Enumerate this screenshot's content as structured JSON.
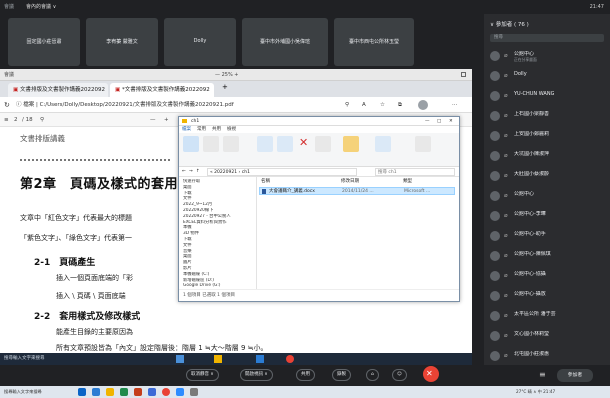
{
  "topbar": {
    "app": "會議",
    "title": "會內的會議 ∨",
    "clock": "21:47"
  },
  "tiles": [
    "固定國小莊晉肅",
    "李宥蓁 嚴雅文",
    "Dolly",
    "臺中市外埔國小吳偉瑄",
    "臺中市西屯公所林玉瑩"
  ],
  "share": {
    "top_left": "會議",
    "top_center": "— 25% +",
    "tabs": [
      {
        "label": "文書排版及文書製作講義2022092"
      },
      {
        "label": "*文書排版及文書製作講義2022092"
      }
    ],
    "tab_add": "+",
    "address": "ⓘ 檔案 | C:/Users/Dolly/Desktop/20220921/文書排版及文書製作講義20220921.pdf",
    "pdf_page": "2",
    "pdf_total": "/ 18",
    "doc": {
      "pretitle": "文書排版講義",
      "chapter": "第2章　頁碼及樣式的套用",
      "intro1": "文章中「紅色文字」代表最大的標題",
      "intro2": "「紫色文字」、「綠色文字」代表第一",
      "s21_title": "2-1　頁碼產生",
      "s21_p1": "插入一個頁面底端的「彩",
      "s21_p2": "插入 \\ 頁碼 \\ 頁面底端",
      "s22_title": "2-2　套用樣式及修改樣式",
      "s22_p1": "能產生目錄的主要原因為",
      "s22_p2": "所有文章預設皆為「內文」設定階層後：階層 1 ≒大～階層 9 ≒小。"
    },
    "taskbar_text": "搜尋輸入文字來搜尋"
  },
  "explorer": {
    "title": "ch1",
    "ribbon_tabs": [
      "檔案",
      "常用",
      "共用",
      "檢視"
    ],
    "path": "« 20220921 › ch1",
    "search": "搜尋 ch1",
    "nav": [
      "快速存取",
      "桌面",
      "下載",
      "文件",
      "2022_9~12月",
      "20220920線下",
      "20220927 - 台中公務人",
      "EXCEL資料分析與實作",
      "本機",
      "3D 物件",
      "下載",
      "文件",
      "音樂",
      "桌面",
      "圖片",
      "影片",
      "本機磁碟 (C:)",
      "新增磁碟區 (D:)",
      "Google Drive (G:)"
    ],
    "columns": [
      "名稱",
      "修改日期",
      "類型"
    ],
    "file": {
      "name": "大會議職介_講義.docx",
      "date": "2014/11/24 ...",
      "type": "Microsoft ..."
    },
    "status": "1 個項目 已選取 1 個項目"
  },
  "sidebar": {
    "header": "∨ 參加者 ( 76 )",
    "search": "搜尋",
    "people": [
      {
        "name": "公館中心",
        "sub": "正在分享畫面"
      },
      {
        "name": "Dolly",
        "sub": ""
      },
      {
        "name": "YU-CHUN WANG",
        "sub": ""
      },
      {
        "name": "上石國小梁靜善",
        "sub": ""
      },
      {
        "name": "上安國小鄭麗莉",
        "sub": ""
      },
      {
        "name": "大坑國小陳淑萍",
        "sub": ""
      },
      {
        "name": "大肚國小蔡淑齡",
        "sub": ""
      },
      {
        "name": "公館中心",
        "sub": ""
      },
      {
        "name": "公館中心-李曄",
        "sub": ""
      },
      {
        "name": "公館中心-助手",
        "sub": ""
      },
      {
        "name": "公館中心-陳佩琪",
        "sub": ""
      },
      {
        "name": "公館中心-協攝",
        "sub": ""
      },
      {
        "name": "公館中心-攝放",
        "sub": ""
      },
      {
        "name": "太平區公所 潘于芸",
        "sub": ""
      },
      {
        "name": "文心國小林莉瑩",
        "sub": ""
      },
      {
        "name": "北屯國小莊淑惠",
        "sub": ""
      }
    ]
  },
  "bottom_bar": {
    "buttons": [
      "取消靜音 ∨",
      "開啟視訊 ∨",
      "共用",
      "錄製",
      "⌂",
      "☺"
    ],
    "participants": "參加者"
  },
  "win_taskbar": {
    "search": "搜尋輸入文字來搜尋",
    "tray": "27°C 晴 ∧ 中 21:47"
  }
}
